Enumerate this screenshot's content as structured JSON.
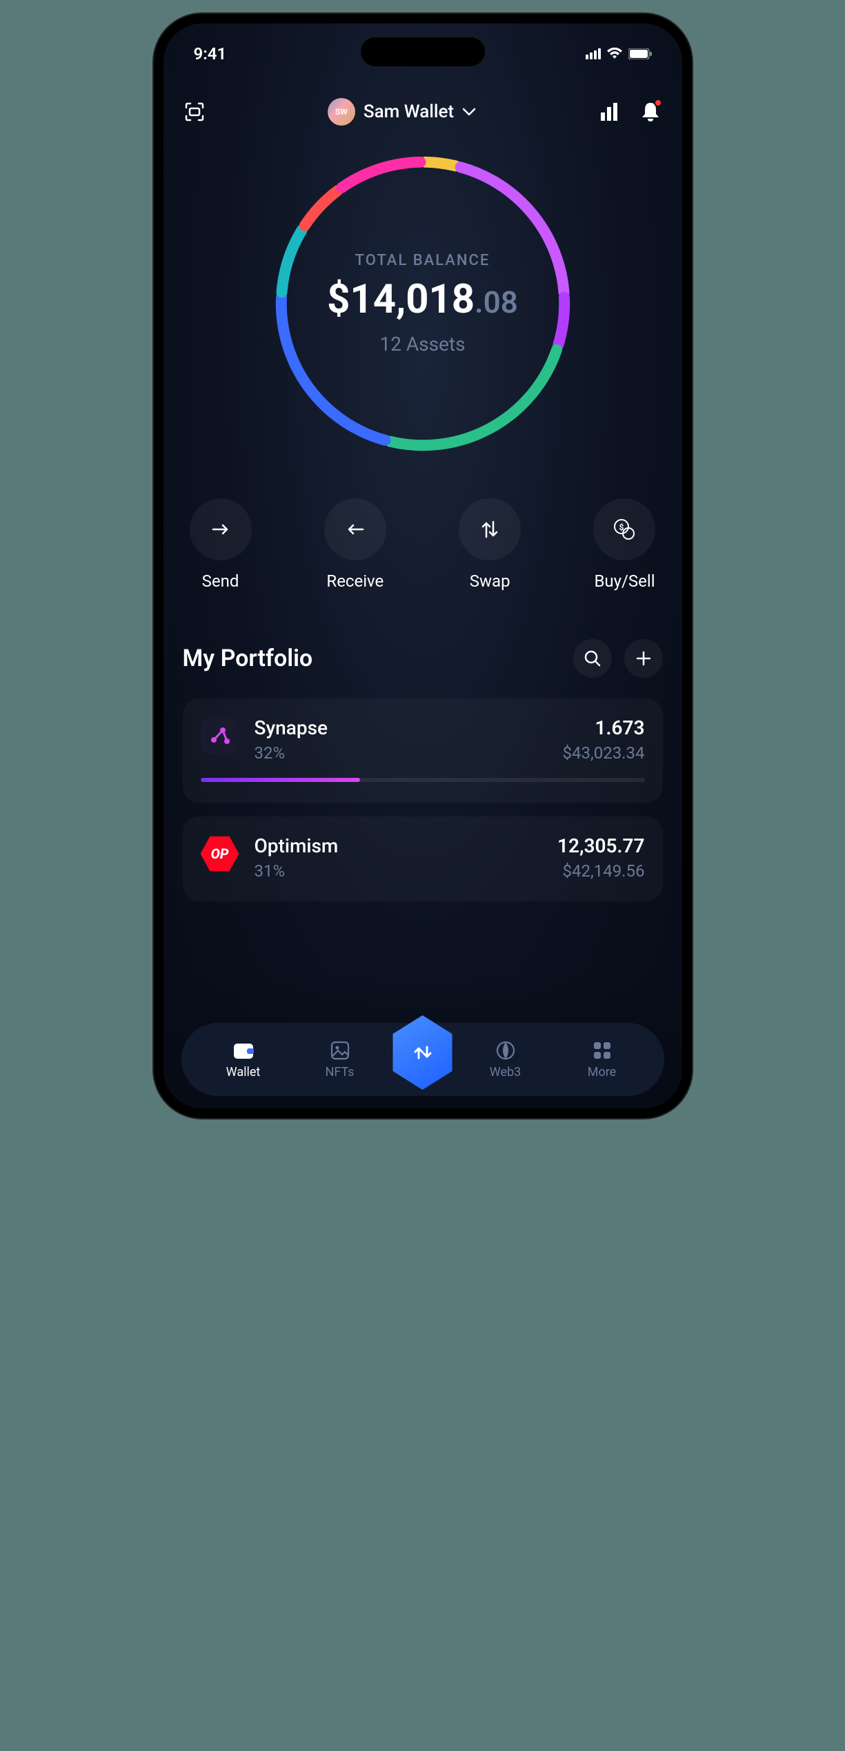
{
  "status": {
    "time": "9:41"
  },
  "header": {
    "avatar_initials": "SW",
    "wallet_name": "Sam Wallet"
  },
  "balance": {
    "label": "TOTAL BALANCE",
    "currency": "$",
    "whole": "14,018",
    "cents": ".08",
    "assets_text": "12 Assets"
  },
  "chart_data": {
    "type": "pie",
    "title": "Portfolio allocation",
    "series": [
      {
        "name": "yellow",
        "value": 4,
        "color": "#f5c542"
      },
      {
        "name": "violet",
        "value": 20,
        "color": "#c85aff"
      },
      {
        "name": "magenta",
        "value": 6,
        "color": "#b23cff"
      },
      {
        "name": "green",
        "value": 24,
        "color": "#2bbf8a"
      },
      {
        "name": "blue",
        "value": 22,
        "color": "#3b6bff"
      },
      {
        "name": "cyan",
        "value": 8,
        "color": "#1bb8c4"
      },
      {
        "name": "red",
        "value": 6,
        "color": "#ff4d4d"
      },
      {
        "name": "pink",
        "value": 10,
        "color": "#ff2ea6"
      }
    ]
  },
  "actions": {
    "send": "Send",
    "receive": "Receive",
    "swap": "Swap",
    "buysell": "Buy/Sell"
  },
  "portfolio": {
    "title": "My Portfolio",
    "items": [
      {
        "name": "Synapse",
        "pct": "32%",
        "amount": "1.673",
        "usd": "$43,023.34",
        "bar_pct": 36,
        "bar_color": "linear-gradient(90deg,#7b2ff7,#d946ef)",
        "icon": "synapse"
      },
      {
        "name": "Optimism",
        "pct": "31%",
        "amount": "12,305.77",
        "usd": "$42,149.56",
        "bar_pct": 31,
        "bar_color": "#ff0420",
        "icon": "optimism"
      }
    ]
  },
  "nav": {
    "wallet": "Wallet",
    "nfts": "NFTs",
    "web3": "Web3",
    "more": "More"
  }
}
